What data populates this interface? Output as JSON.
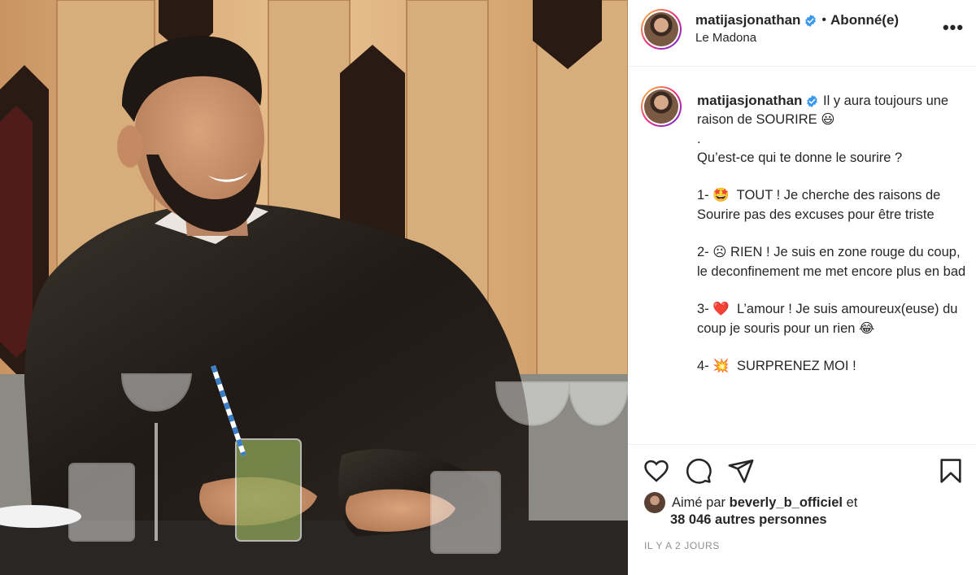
{
  "post": {
    "username": "matijasjonathan",
    "follow_status": "Abonné(e)",
    "location": "Le Madona",
    "caption_username": "matijasjonathan",
    "caption_text": " Il y aura toujours une raison de SOURIRE 😃\n.\nQu’est-ce qui te donne le sourire ?\n\n1- 🤩  TOUT ! Je cherche des raisons de Sourire pas des excuses pour être triste\n\n2- ☹ RIEN ! Je suis en zone rouge du coup, le deconfinement me met encore plus en bad\n\n3- ❤️  L’amour ! Je suis amoureux(euse) du coup je souris pour un rien 😂\n\n4- 💥  SURPRENEZ MOI !",
    "likes_prefix": "Aimé par ",
    "liked_by": "beverly_b_officiel",
    "likes_suffix": " et",
    "likes_others": "38 046 autres personnes",
    "timestamp": "IL Y A 2 JOURS",
    "more_label": "•••"
  },
  "icons": {
    "verified": "verified-badge-icon",
    "more": "more-options-icon",
    "like": "heart-icon",
    "comment": "comment-icon",
    "share": "paper-plane-icon",
    "save": "bookmark-icon"
  },
  "colors": {
    "verified_blue": "#3897f0",
    "text": "#262626",
    "muted": "#8e8e8e",
    "border": "#efefef"
  }
}
